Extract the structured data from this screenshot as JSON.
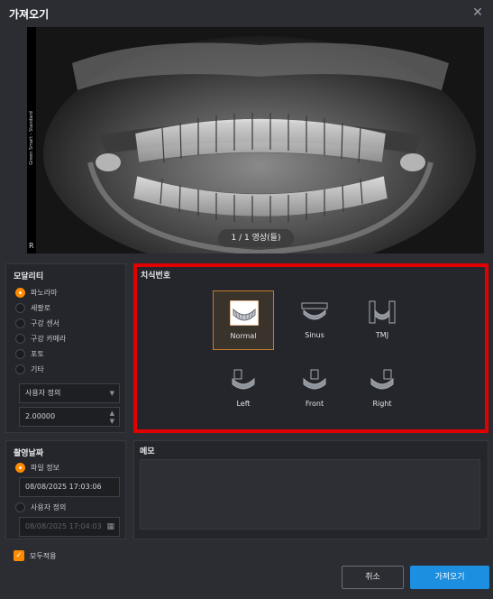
{
  "window": {
    "title": "가져오기"
  },
  "viewer": {
    "strip_label": "Green Smart - Standard",
    "side_marker": "R",
    "image_counter": "1 / 1 영상(들)"
  },
  "modality": {
    "title": "모달리티",
    "options": [
      {
        "label": "파노라마",
        "selected": true
      },
      {
        "label": "세팔로",
        "selected": false
      },
      {
        "label": "구강 센서",
        "selected": false
      },
      {
        "label": "구강 카메라",
        "selected": false
      },
      {
        "label": "포토",
        "selected": false
      },
      {
        "label": "기타",
        "selected": false
      }
    ],
    "dropdown_value": "사용자 정의",
    "spinner_value": "2.00000"
  },
  "tooth": {
    "title": "치식번호",
    "items": [
      {
        "label": "Normal",
        "selected": true
      },
      {
        "label": "Sinus",
        "selected": false
      },
      {
        "label": "TMJ",
        "selected": false
      },
      {
        "label": "Left",
        "selected": false
      },
      {
        "label": "Front",
        "selected": false
      },
      {
        "label": "Right",
        "selected": false
      }
    ]
  },
  "capture_date": {
    "title": "촬영날짜",
    "file_info_label": "파일 정보",
    "file_info_value": "08/08/2025 17:03:06",
    "custom_label": "사용자 정의",
    "custom_value": "08/08/2025 17:04:03"
  },
  "memo": {
    "title": "메모"
  },
  "apply_all": {
    "label": "모두적용",
    "checked": true
  },
  "buttons": {
    "cancel": "취소",
    "import": "가져오기"
  },
  "colors": {
    "accent": "#ff8a00",
    "primary": "#1d8fe0",
    "highlight_border": "#e00000"
  }
}
